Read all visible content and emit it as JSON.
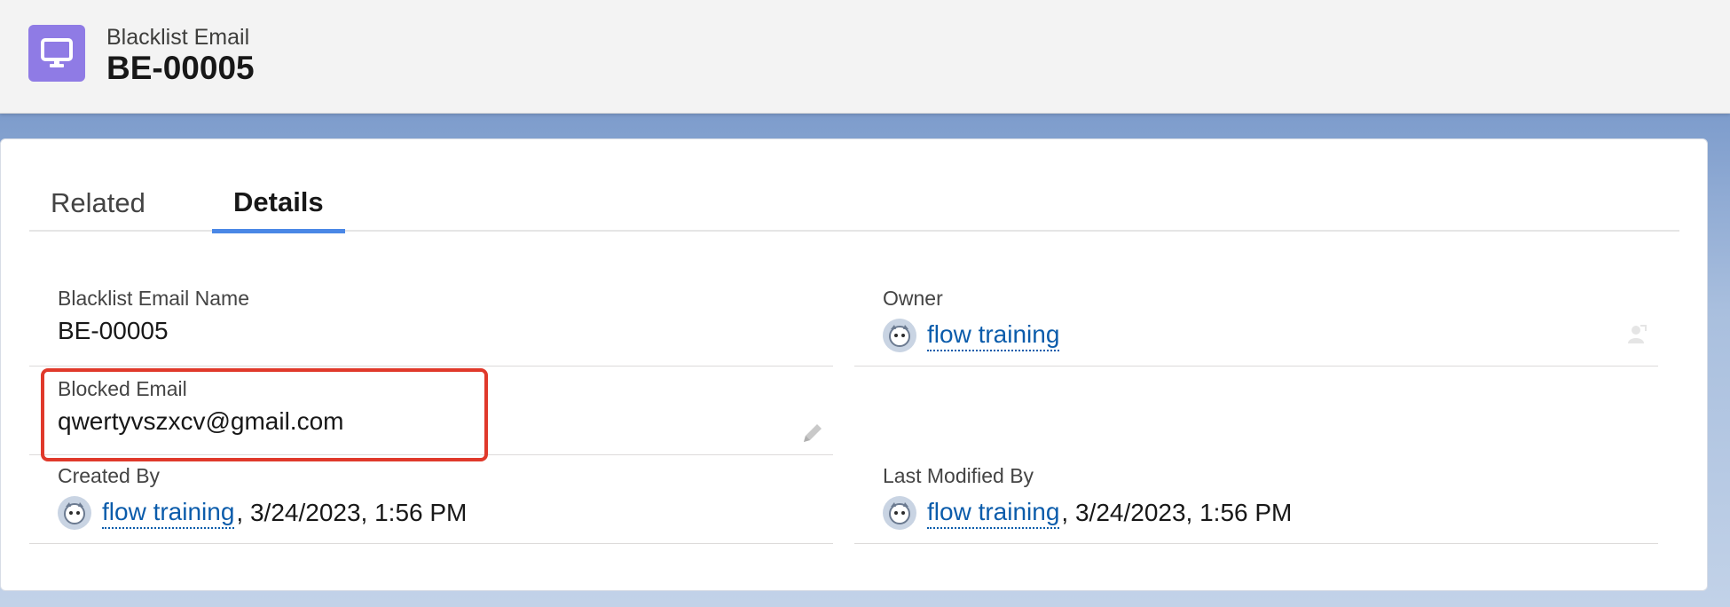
{
  "header": {
    "object_type": "Blacklist Email",
    "record_name": "BE-00005",
    "icon": "desktop-icon",
    "icon_color": "#8f7be5"
  },
  "tabs": [
    {
      "label": "Related",
      "active": false
    },
    {
      "label": "Details",
      "active": true
    }
  ],
  "fields": {
    "name": {
      "label": "Blacklist Email Name",
      "value": "BE-00005"
    },
    "owner": {
      "label": "Owner",
      "value": "flow training"
    },
    "blocked_email": {
      "label": "Blocked Email",
      "value": "qwertyvszxcv@gmail.com"
    },
    "created_by": {
      "label": "Created By",
      "user": "flow training",
      "date": ", 3/24/2023, 1:56 PM"
    },
    "last_modified_by": {
      "label": "Last Modified By",
      "user": "flow training",
      "date": ", 3/24/2023, 1:56 PM"
    }
  },
  "colors": {
    "accent": "#4a87e6",
    "link": "#0b5cab",
    "highlight": "#e0392b"
  }
}
